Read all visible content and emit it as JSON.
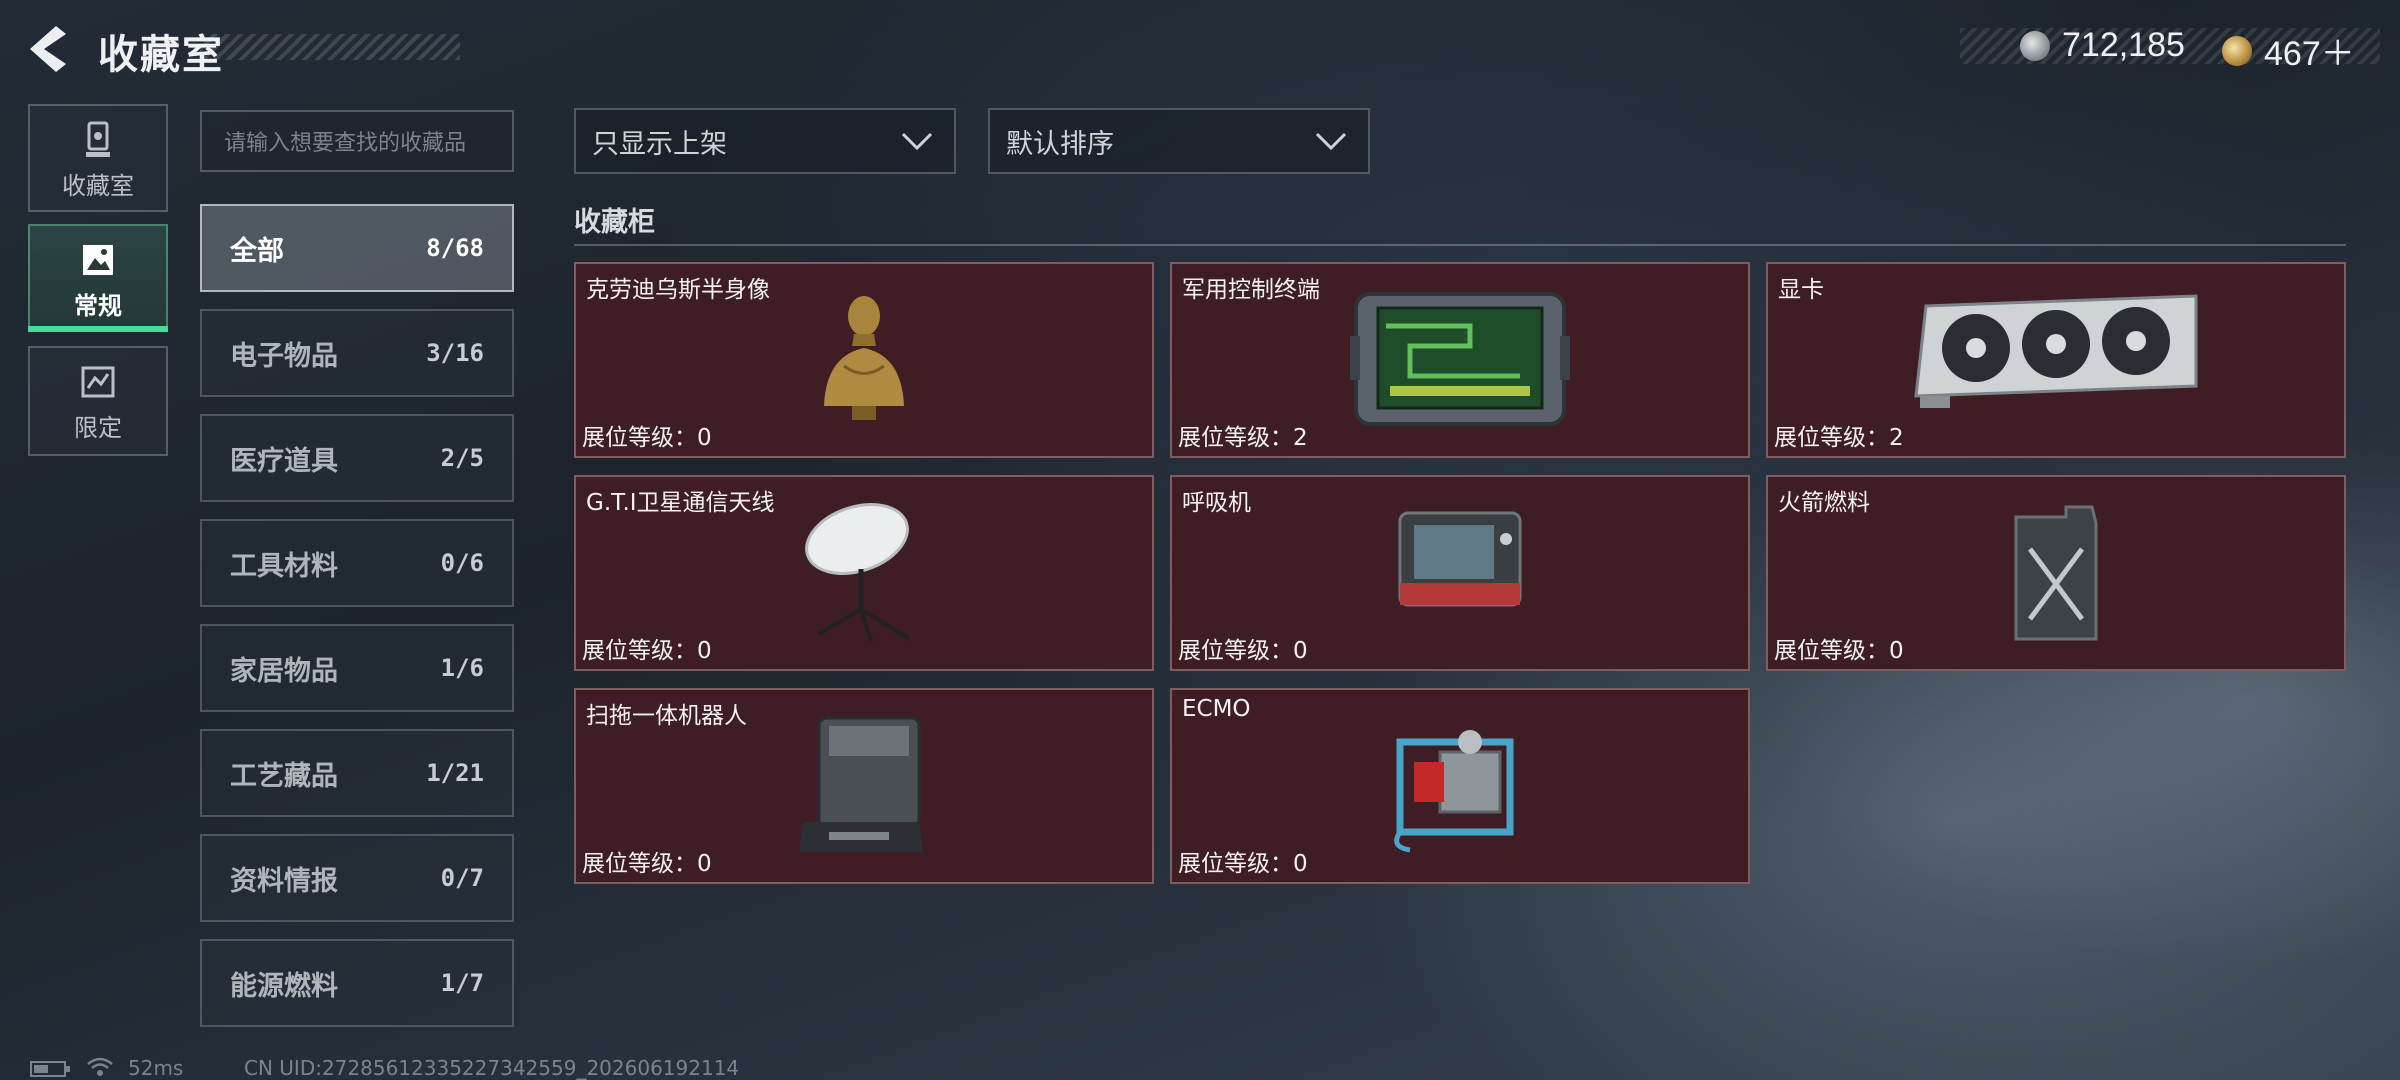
{
  "header": {
    "title": "收藏室",
    "currency_silver": "712,185",
    "currency_gold": "467＋"
  },
  "nav": [
    {
      "label": "收藏室",
      "icon": "trophy-icon"
    },
    {
      "label": "常规",
      "icon": "picture-icon",
      "active": true
    },
    {
      "label": "限定",
      "icon": "limited-icon"
    }
  ],
  "search": {
    "placeholder": "请输入想要查找的收藏品"
  },
  "categories": [
    {
      "name": "全部",
      "count": "8/68",
      "active": true
    },
    {
      "name": "电子物品",
      "count": "3/16"
    },
    {
      "name": "医疗道具",
      "count": "2/5"
    },
    {
      "name": "工具材料",
      "count": "0/6"
    },
    {
      "name": "家居物品",
      "count": "1/6"
    },
    {
      "name": "工艺藏品",
      "count": "1/21"
    },
    {
      "name": "资料情报",
      "count": "0/7"
    },
    {
      "name": "能源燃料",
      "count": "1/7"
    }
  ],
  "filters": {
    "show": "只显示上架",
    "sort": "默认排序"
  },
  "section_title": "收藏柜",
  "items": [
    {
      "name": "克劳迪乌斯半身像",
      "level": "展位等级：0",
      "icon": "bust-icon"
    },
    {
      "name": "军用控制终端",
      "level": "展位等级：2",
      "icon": "terminal-icon"
    },
    {
      "name": "显卡",
      "level": "展位等级：2",
      "icon": "gpu-icon"
    },
    {
      "name": "G.T.I卫星通信天线",
      "level": "展位等级：0",
      "icon": "satellite-dish-icon"
    },
    {
      "name": "呼吸机",
      "level": "展位等级：0",
      "icon": "ventilator-icon"
    },
    {
      "name": "火箭燃料",
      "level": "展位等级：0",
      "icon": "fuel-can-icon"
    },
    {
      "name": "扫拖一体机器人",
      "level": "展位等级：0",
      "icon": "robot-vacuum-icon"
    },
    {
      "name": "ECMO",
      "level": "展位等级：0",
      "icon": "ecmo-icon"
    }
  ],
  "status": {
    "ping": "52ms",
    "uid": "CN UID:27285612335227342559_202606192114"
  },
  "colors": {
    "accent": "#3fdc9a",
    "card_bg": "#3e1e24"
  }
}
